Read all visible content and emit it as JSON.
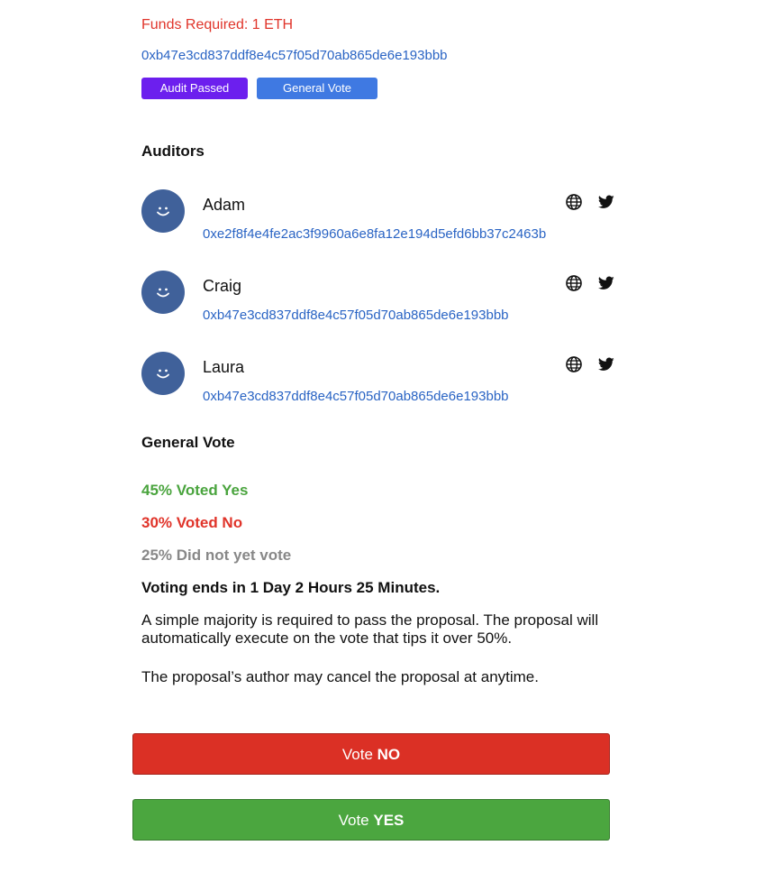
{
  "proposal": {
    "funds_required": "Funds Required: 1 ETH",
    "address": "0xb47e3cd837ddf8e4c57f05d70ab865de6e193bbb",
    "badges": {
      "audit": "Audit Passed",
      "vote": "General Vote"
    }
  },
  "auditors": {
    "title": "Auditors",
    "list": [
      {
        "name": "Adam",
        "address": "0xe2f8f4e4fe2ac3f9960a6e8fa12e194d5efd6bb37c2463b"
      },
      {
        "name": "Craig",
        "address": "0xb47e3cd837ddf8e4c57f05d70ab865de6e193bbb"
      },
      {
        "name": "Laura",
        "address": "0xb47e3cd837ddf8e4c57f05d70ab865de6e193bbb"
      }
    ],
    "icons": {
      "website": "globe-icon",
      "social": "twitter-icon",
      "avatar": "smiley-icon"
    }
  },
  "general_vote": {
    "title": "General Vote",
    "yes": "45% Voted Yes",
    "no": "30% Voted No",
    "pending": "25% Did not yet vote",
    "ends": "Voting ends in 1 Day 2 Hours 25 Minutes.",
    "description": "A simple majority is required to pass the proposal. The proposal will automatically execute on the vote that tips it over 50%.",
    "cancel_note": "The proposal’s author may cancel the proposal at anytime."
  },
  "actions": {
    "vote_no_prefix": "Vote ",
    "vote_no_strong": "NO",
    "vote_yes_prefix": "Vote ",
    "vote_yes_strong": "YES"
  },
  "colors": {
    "red": "#e0342a",
    "green": "#4aa43e",
    "link": "#2a64c4",
    "audit_badge": "#6c1fee",
    "vote_badge": "#3f79e2",
    "avatar": "#40619a"
  }
}
